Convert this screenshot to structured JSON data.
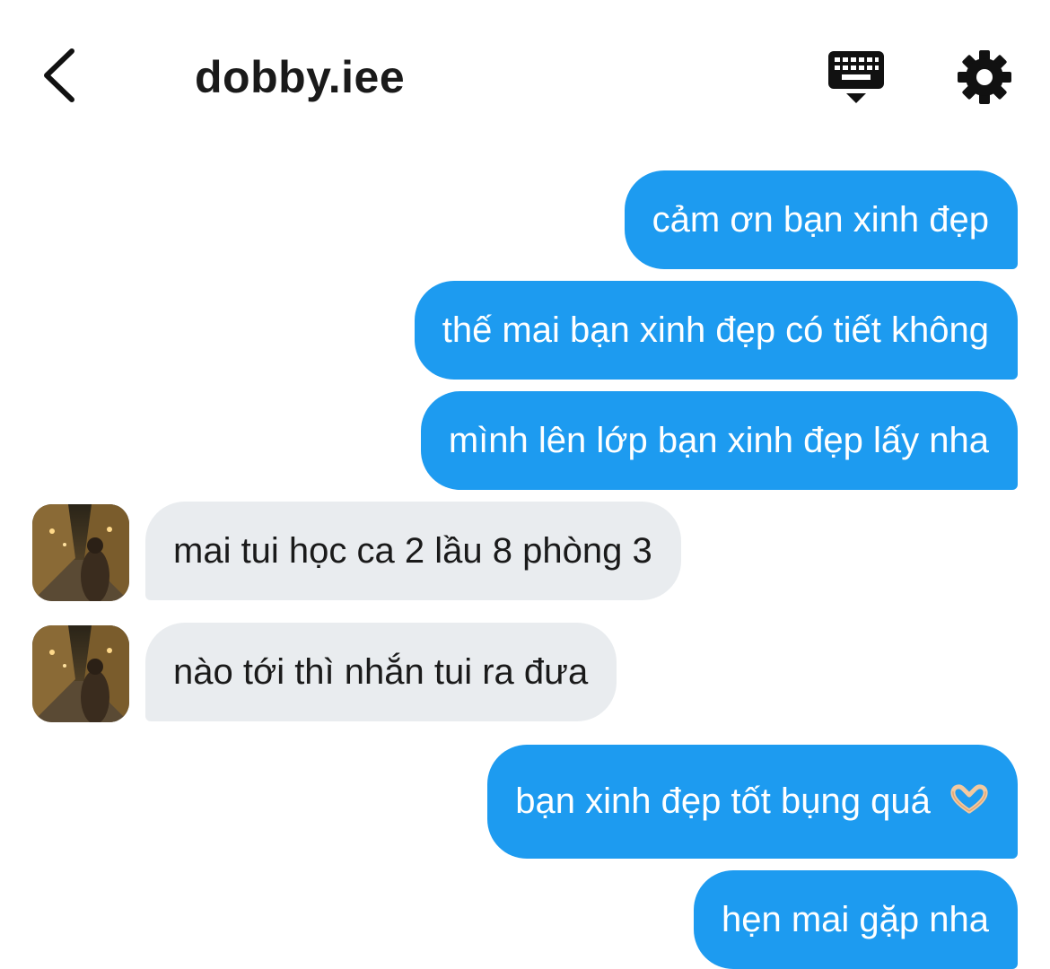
{
  "header": {
    "title": "dobby.iee",
    "back_icon": "chevron-left-icon",
    "keyboard_icon": "keyboard-icon",
    "settings_icon": "gear-icon"
  },
  "messages": [
    {
      "side": "sent",
      "text": "cảm ơn bạn xinh đẹp"
    },
    {
      "side": "sent",
      "text": "thế mai bạn xinh đẹp có tiết không"
    },
    {
      "side": "sent",
      "text": "mình lên lớp bạn xinh đẹp lấy nha"
    },
    {
      "side": "received",
      "text": "mai tui học ca 2 lầu 8 phòng 3"
    },
    {
      "side": "received",
      "text": "nào tới thì nhắn tui ra đưa"
    },
    {
      "side": "sent",
      "text": "bạn xinh đẹp tốt bụng quá",
      "emoji": "heart-hands-icon"
    },
    {
      "side": "sent",
      "text": "hẹn mai gặp nha"
    }
  ],
  "colors": {
    "sent_bubble": "#1d9bf0",
    "received_bubble": "#e9ecef",
    "text_dark": "#1a1a1a"
  }
}
